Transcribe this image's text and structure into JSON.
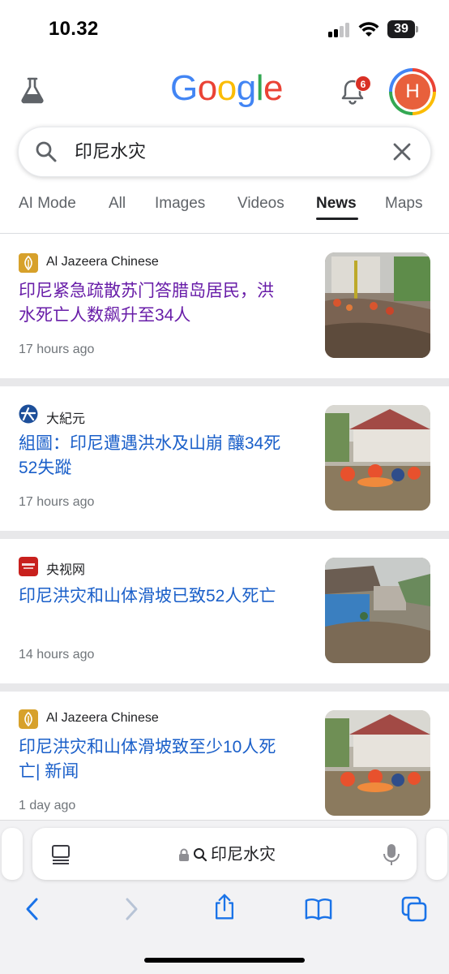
{
  "status_bar": {
    "time": "10.32",
    "battery": "39"
  },
  "header": {
    "logo_letters": [
      "G",
      "o",
      "o",
      "g",
      "l",
      "e"
    ],
    "notification_count": "6",
    "avatar_initial": "H"
  },
  "search": {
    "query": "印尼水灾"
  },
  "tabs": [
    {
      "label": "AI Mode",
      "active": false
    },
    {
      "label": "All",
      "active": false
    },
    {
      "label": "Images",
      "active": false
    },
    {
      "label": "Videos",
      "active": false
    },
    {
      "label": "News",
      "active": true
    },
    {
      "label": "Maps",
      "active": false
    }
  ],
  "news": [
    {
      "source": "Al Jazeera Chinese",
      "headline_line1": "印尼紧急疏散苏门答腊岛居民，洪",
      "headline_line2": "水死亡人数飙升至34人",
      "time": "17 hours ago",
      "visited": true,
      "source_icon_color": "#d7a12b"
    },
    {
      "source": "大紀元",
      "headline_line1": "組圖：印尼遭遇洪水及山崩 釀34死",
      "headline_line2": "52失蹤",
      "time": "17 hours ago",
      "visited": false,
      "source_icon_color": "#1d4f9a"
    },
    {
      "source": "央视网",
      "headline_line1": "印尼洪灾和山体滑坡已致52人死亡",
      "headline_line2": "",
      "time": "14 hours ago",
      "visited": false,
      "source_icon_color": "#c8201d"
    },
    {
      "source": "Al Jazeera Chinese",
      "headline_line1": "印尼洪灾和山体滑坡致至少10人死",
      "headline_line2": "亡| 新闻",
      "time": "1 day ago",
      "visited": false,
      "source_icon_color": "#d7a12b"
    }
  ],
  "browser": {
    "address": "印尼水灾"
  },
  "colors": {
    "visited_link": "#681da8",
    "link": "#1a5fc9",
    "safari_blue": "#1a73e8"
  }
}
